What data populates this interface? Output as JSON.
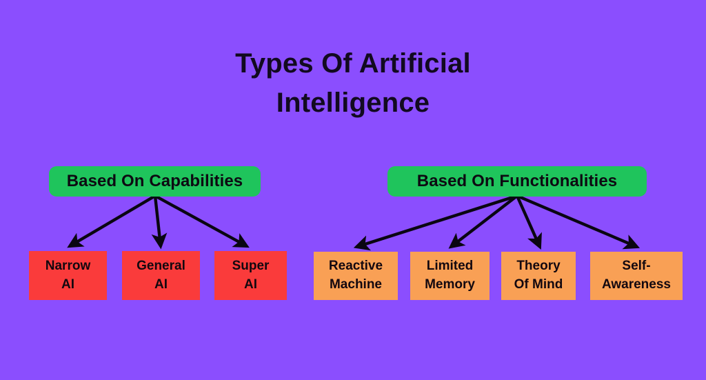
{
  "colors": {
    "background": "#8B4EFE",
    "header": "#1FC45C",
    "capability_leaf": "#FA3B3B",
    "functionality_leaf": "#F9A055",
    "text": "#120a20",
    "arrow": "#0a0612"
  },
  "title": {
    "line1": "Types Of Artificial",
    "line2": "Intelligence"
  },
  "branches": [
    {
      "id": "capabilities",
      "header": "Based On Capabilities",
      "leaves": [
        {
          "line1": "Narrow",
          "line2": "AI"
        },
        {
          "line1": "General",
          "line2": "AI"
        },
        {
          "line1": "Super",
          "line2": "AI"
        }
      ]
    },
    {
      "id": "functionalities",
      "header": "Based On Functionalities",
      "leaves": [
        {
          "line1": "Reactive",
          "line2": "Machine"
        },
        {
          "line1": "Limited",
          "line2": "Memory"
        },
        {
          "line1": "Theory",
          "line2": "Of Mind"
        },
        {
          "line1": "Self-",
          "line2": "Awareness"
        }
      ]
    }
  ]
}
